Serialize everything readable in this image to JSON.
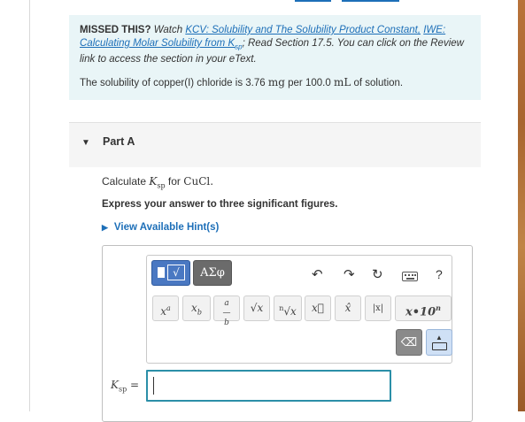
{
  "missed": {
    "lead": "MISSED THIS?",
    "watch": "Watch",
    "link1": "KCV: Solubility and The Solubility Product Constant,",
    "link2_pre": "IWE: Calculating Molar Solubility from K",
    "link2_sub": "sp",
    "after_link": "; Read Section 17.5. You can click on the Review link to access the section in your eText.",
    "sol_pre": "The solubility of copper(I) chloride is 3.76",
    "sol_unit1": "mg",
    "sol_mid": "per 100.0",
    "sol_unit2": "mL",
    "sol_post": "of solution."
  },
  "part": {
    "title": "Part A",
    "question_pre": "Calculate",
    "question_k": "K",
    "question_ksub": "sp",
    "question_mid": "for",
    "question_formula": "CuCl.",
    "instruction": "Express your answer to three significant figures.",
    "hints_label": "View Available Hint(s)"
  },
  "toolbar": {
    "templates_icon": "templates-icon",
    "greek_label": "ΑΣφ",
    "undo_icon": "undo-icon",
    "redo_icon": "redo-icon",
    "reset_icon": "reset-icon",
    "keyboard_icon": "keyboard-icon",
    "help_label": "?"
  },
  "math_buttons": [
    {
      "name": "superscript-button",
      "label": "x"
    },
    {
      "name": "subscript-button",
      "label": "x"
    },
    {
      "name": "fraction-button",
      "label": "a/b"
    },
    {
      "name": "sqrt-button",
      "label": "√x"
    },
    {
      "name": "nthroot-button",
      "label": "ⁿ√x"
    },
    {
      "name": "vector-button",
      "label": "x⃗"
    },
    {
      "name": "hat-button",
      "label": "x̂"
    },
    {
      "name": "abs-button",
      "label": "|x|"
    },
    {
      "name": "scientific-notation-button",
      "label": "x•10ⁿ"
    }
  ],
  "answer": {
    "label_k": "K",
    "label_sub": "sp",
    "label_eq": "=",
    "value": ""
  },
  "colors": {
    "accent": "#1d6fb8",
    "missed_bg": "#e9f5f7",
    "input_border": "#2b8fa8"
  }
}
